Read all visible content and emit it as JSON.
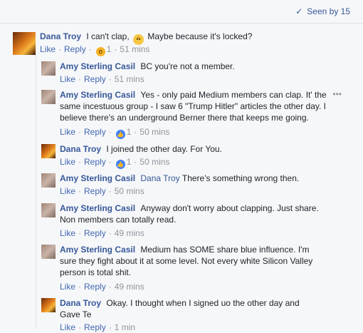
{
  "header": {
    "seen_by": "Seen by 15"
  },
  "comments": [
    {
      "name": "Dana Troy",
      "text_before": "I can't clap,",
      "text_after": "Maybe because it's locked?",
      "like": "Like",
      "reply": "Reply",
      "reaction_count": "1",
      "time": "51 mins"
    },
    {
      "name": "Amy Sterling Casil",
      "text": "BC you're not a member.",
      "like": "Like",
      "reply": "Reply",
      "time": "51 mins"
    },
    {
      "name": "Amy Sterling Casil",
      "text": "Yes - only paid Medium members can clap. It' the same incestuous group - I saw 6 \"Trump Hitler\" articles the other day. I believe there's an underground Berner there that keeps me going.",
      "like": "Like",
      "reply": "Reply",
      "reaction_count": "1",
      "time": "50 mins",
      "more": "•••"
    },
    {
      "name": "Dana Troy",
      "text": "I joined the other day. For You.",
      "like": "Like",
      "reply": "Reply",
      "reaction_count": "1",
      "time": "50 mins"
    },
    {
      "name": "Amy Sterling Casil",
      "mention": "Dana Troy",
      "text": "There's something wrong then.",
      "like": "Like",
      "reply": "Reply",
      "time": "50 mins"
    },
    {
      "name": "Amy Sterling Casil",
      "text": "Anyway don't worry about clapping. Just share. Non members can totally read.",
      "like": "Like",
      "reply": "Reply",
      "time": "49 mins"
    },
    {
      "name": "Amy Sterling Casil",
      "text": "Medium has SOME share blue influence. I'm sure they fight about it at some level. Not every white Silicon Valley person is total shit.",
      "like": "Like",
      "reply": "Reply",
      "time": "49 mins"
    },
    {
      "name": "Dana Troy",
      "text": "Okay. I thought when I signed uo the other day and Gave Te",
      "like": "Like",
      "reply": "Reply",
      "time": "1 min"
    }
  ],
  "separator": "·",
  "colors": {
    "link": "#365899",
    "action": "#4267b2",
    "muted": "#90949c",
    "background": "#f6f7f9"
  }
}
